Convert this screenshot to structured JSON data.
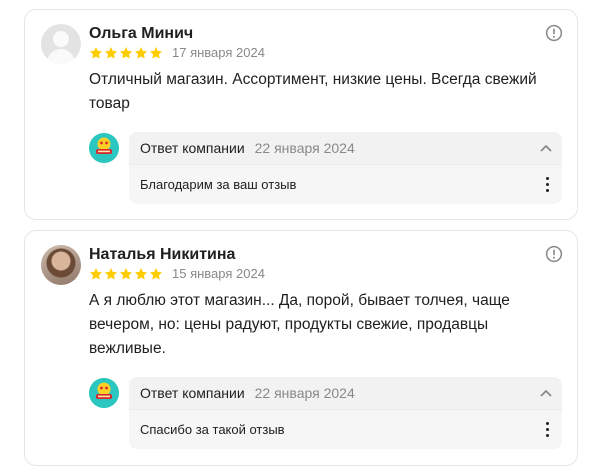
{
  "reviews": [
    {
      "author": "Ольга Минич",
      "rating": 5,
      "date": "17 января 2024",
      "text": "Отличный магазин. Ассортимент, низкие цены. Всегда свежий товар",
      "reply": {
        "title": "Ответ компании",
        "date": "22 января 2024",
        "text": "Благодарим за ваш отзыв"
      }
    },
    {
      "author": "Наталья Никитина",
      "rating": 5,
      "date": "15 января 2024",
      "text": "А я люблю этот магазин... Да, порой, бывает толчея, чаще вечером, но: цены радуют, продукты свежие, продавцы вежливые.",
      "reply": {
        "title": "Ответ компании",
        "date": "22 января 2024",
        "text": "Спасибо за такой отзыв"
      }
    }
  ],
  "colors": {
    "star": "#fc0",
    "muted": "#898989",
    "logo_bg": "#2cc6c1"
  },
  "icons": {
    "report": "exclamation-circle-icon",
    "collapse": "chevron-up-icon",
    "more": "kebab-menu-icon"
  }
}
